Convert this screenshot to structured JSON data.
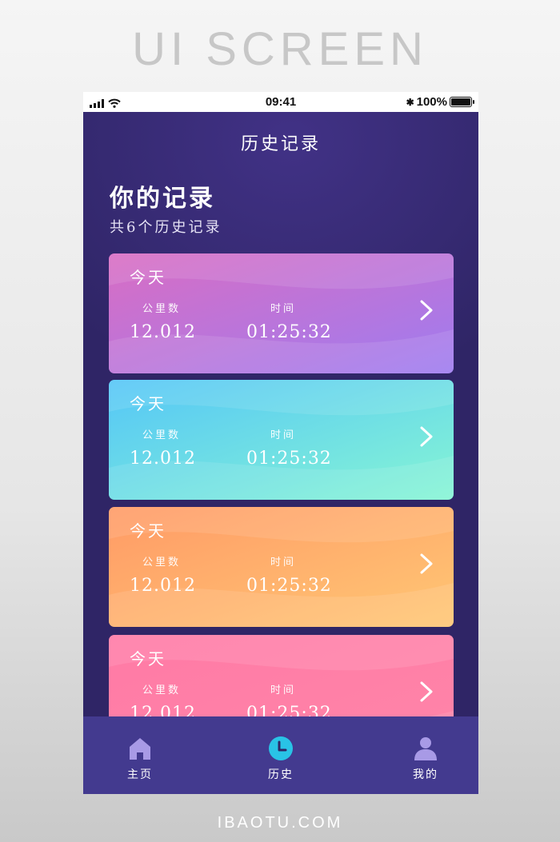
{
  "banner": {
    "title": "UI SCREEN"
  },
  "footer": {
    "brand": "IBAOTU.COM"
  },
  "status_bar": {
    "time": "09:41",
    "battery": "100%",
    "bluetooth_glyph": "✱"
  },
  "nav": {
    "title": "历史记录"
  },
  "header": {
    "title": "你的记录",
    "subtitle": "共6个历史记录"
  },
  "records": [
    {
      "day": "今天",
      "distance_label": "公里数",
      "time_label": "时间",
      "distance": "12.012",
      "duration": "01:25:32",
      "colors": [
        "#d96dc3",
        "#9e7cf0"
      ]
    },
    {
      "day": "今天",
      "distance_label": "公里数",
      "time_label": "时间",
      "distance": "12.012",
      "duration": "01:25:32",
      "colors": [
        "#55c6f7",
        "#86f5d4"
      ]
    },
    {
      "day": "今天",
      "distance_label": "公里数",
      "time_label": "时间",
      "distance": "12.012",
      "duration": "01:25:32",
      "colors": [
        "#ff9a66",
        "#ffc774"
      ]
    },
    {
      "day": "今天",
      "distance_label": "公里数",
      "time_label": "时间",
      "distance": "12.012",
      "duration": "01:25:32",
      "colors": [
        "#ff7aa6",
        "#ff85a8"
      ]
    }
  ],
  "tabs": [
    {
      "label": "主页",
      "icon": "home-icon"
    },
    {
      "label": "历史",
      "icon": "clock-icon"
    },
    {
      "label": "我的",
      "icon": "user-icon"
    }
  ],
  "colors": {
    "screen_background": "#2f2566",
    "tab_bar": "#433a8f",
    "tab_icon_inactive": "#a89ae6",
    "tab_icon_active": "#29c3e6"
  }
}
